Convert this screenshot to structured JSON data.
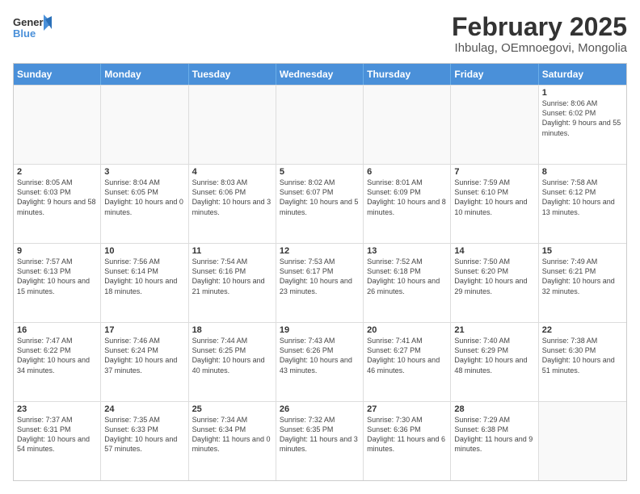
{
  "logo": {
    "line1": "General",
    "line2": "Blue"
  },
  "title": "February 2025",
  "subtitle": "Ihbulag, OEmnoegovi, Mongolia",
  "days": [
    "Sunday",
    "Monday",
    "Tuesday",
    "Wednesday",
    "Thursday",
    "Friday",
    "Saturday"
  ],
  "weeks": [
    [
      {
        "day": "",
        "detail": ""
      },
      {
        "day": "",
        "detail": ""
      },
      {
        "day": "",
        "detail": ""
      },
      {
        "day": "",
        "detail": ""
      },
      {
        "day": "",
        "detail": ""
      },
      {
        "day": "",
        "detail": ""
      },
      {
        "day": "1",
        "detail": "Sunrise: 8:06 AM\nSunset: 6:02 PM\nDaylight: 9 hours and 55 minutes."
      }
    ],
    [
      {
        "day": "2",
        "detail": "Sunrise: 8:05 AM\nSunset: 6:03 PM\nDaylight: 9 hours and 58 minutes."
      },
      {
        "day": "3",
        "detail": "Sunrise: 8:04 AM\nSunset: 6:05 PM\nDaylight: 10 hours and 0 minutes."
      },
      {
        "day": "4",
        "detail": "Sunrise: 8:03 AM\nSunset: 6:06 PM\nDaylight: 10 hours and 3 minutes."
      },
      {
        "day": "5",
        "detail": "Sunrise: 8:02 AM\nSunset: 6:07 PM\nDaylight: 10 hours and 5 minutes."
      },
      {
        "day": "6",
        "detail": "Sunrise: 8:01 AM\nSunset: 6:09 PM\nDaylight: 10 hours and 8 minutes."
      },
      {
        "day": "7",
        "detail": "Sunrise: 7:59 AM\nSunset: 6:10 PM\nDaylight: 10 hours and 10 minutes."
      },
      {
        "day": "8",
        "detail": "Sunrise: 7:58 AM\nSunset: 6:12 PM\nDaylight: 10 hours and 13 minutes."
      }
    ],
    [
      {
        "day": "9",
        "detail": "Sunrise: 7:57 AM\nSunset: 6:13 PM\nDaylight: 10 hours and 15 minutes."
      },
      {
        "day": "10",
        "detail": "Sunrise: 7:56 AM\nSunset: 6:14 PM\nDaylight: 10 hours and 18 minutes."
      },
      {
        "day": "11",
        "detail": "Sunrise: 7:54 AM\nSunset: 6:16 PM\nDaylight: 10 hours and 21 minutes."
      },
      {
        "day": "12",
        "detail": "Sunrise: 7:53 AM\nSunset: 6:17 PM\nDaylight: 10 hours and 23 minutes."
      },
      {
        "day": "13",
        "detail": "Sunrise: 7:52 AM\nSunset: 6:18 PM\nDaylight: 10 hours and 26 minutes."
      },
      {
        "day": "14",
        "detail": "Sunrise: 7:50 AM\nSunset: 6:20 PM\nDaylight: 10 hours and 29 minutes."
      },
      {
        "day": "15",
        "detail": "Sunrise: 7:49 AM\nSunset: 6:21 PM\nDaylight: 10 hours and 32 minutes."
      }
    ],
    [
      {
        "day": "16",
        "detail": "Sunrise: 7:47 AM\nSunset: 6:22 PM\nDaylight: 10 hours and 34 minutes."
      },
      {
        "day": "17",
        "detail": "Sunrise: 7:46 AM\nSunset: 6:24 PM\nDaylight: 10 hours and 37 minutes."
      },
      {
        "day": "18",
        "detail": "Sunrise: 7:44 AM\nSunset: 6:25 PM\nDaylight: 10 hours and 40 minutes."
      },
      {
        "day": "19",
        "detail": "Sunrise: 7:43 AM\nSunset: 6:26 PM\nDaylight: 10 hours and 43 minutes."
      },
      {
        "day": "20",
        "detail": "Sunrise: 7:41 AM\nSunset: 6:27 PM\nDaylight: 10 hours and 46 minutes."
      },
      {
        "day": "21",
        "detail": "Sunrise: 7:40 AM\nSunset: 6:29 PM\nDaylight: 10 hours and 48 minutes."
      },
      {
        "day": "22",
        "detail": "Sunrise: 7:38 AM\nSunset: 6:30 PM\nDaylight: 10 hours and 51 minutes."
      }
    ],
    [
      {
        "day": "23",
        "detail": "Sunrise: 7:37 AM\nSunset: 6:31 PM\nDaylight: 10 hours and 54 minutes."
      },
      {
        "day": "24",
        "detail": "Sunrise: 7:35 AM\nSunset: 6:33 PM\nDaylight: 10 hours and 57 minutes."
      },
      {
        "day": "25",
        "detail": "Sunrise: 7:34 AM\nSunset: 6:34 PM\nDaylight: 11 hours and 0 minutes."
      },
      {
        "day": "26",
        "detail": "Sunrise: 7:32 AM\nSunset: 6:35 PM\nDaylight: 11 hours and 3 minutes."
      },
      {
        "day": "27",
        "detail": "Sunrise: 7:30 AM\nSunset: 6:36 PM\nDaylight: 11 hours and 6 minutes."
      },
      {
        "day": "28",
        "detail": "Sunrise: 7:29 AM\nSunset: 6:38 PM\nDaylight: 11 hours and 9 minutes."
      },
      {
        "day": "",
        "detail": ""
      }
    ]
  ]
}
